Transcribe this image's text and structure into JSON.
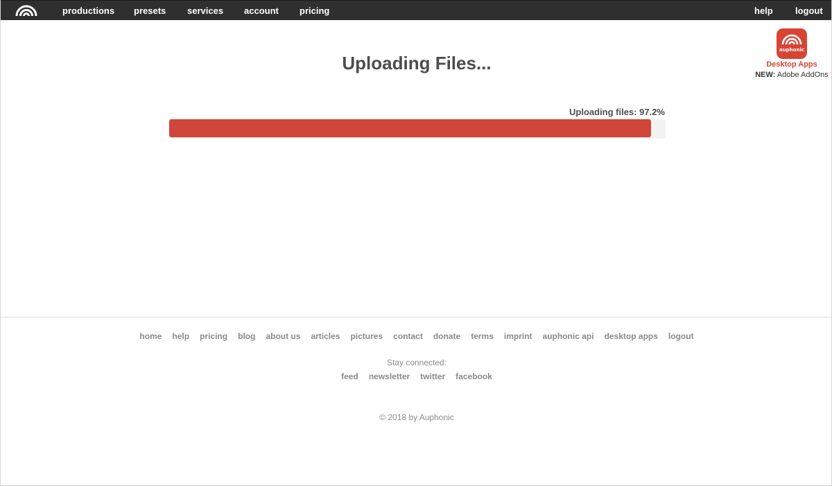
{
  "navbar": {
    "logo_icon": "auphonic-arcs-icon",
    "left_items": [
      {
        "label": "productions"
      },
      {
        "label": "presets"
      },
      {
        "label": "services"
      },
      {
        "label": "account"
      },
      {
        "label": "pricing"
      }
    ],
    "right_items": [
      {
        "label": "help"
      },
      {
        "label": "logout"
      }
    ],
    "background_color": "#2f2f2f"
  },
  "promo": {
    "icon_text": "auphonic",
    "apps_label": "Desktop Apps",
    "new_prefix": "NEW:",
    "new_text": "Adobe AddOns",
    "accent_color": "#d84434"
  },
  "upload": {
    "title": "Uploading Files...",
    "progress_label": "Uploading files: 97.2%",
    "progress_percent": 97.2,
    "bar_color": "#d0463a"
  },
  "footer": {
    "links": [
      {
        "label": "home"
      },
      {
        "label": "help"
      },
      {
        "label": "pricing"
      },
      {
        "label": "blog"
      },
      {
        "label": "about us"
      },
      {
        "label": "articles"
      },
      {
        "label": "pictures"
      },
      {
        "label": "contact"
      },
      {
        "label": "donate"
      },
      {
        "label": "terms"
      },
      {
        "label": "imprint"
      },
      {
        "label": "auphonic api"
      },
      {
        "label": "desktop apps"
      },
      {
        "label": "logout"
      }
    ],
    "stay_connected": "Stay connected:",
    "social": [
      {
        "label": "feed"
      },
      {
        "label": "newsletter"
      },
      {
        "label": "twitter"
      },
      {
        "label": "facebook"
      }
    ],
    "copyright": "© 2018 by Auphonic"
  }
}
